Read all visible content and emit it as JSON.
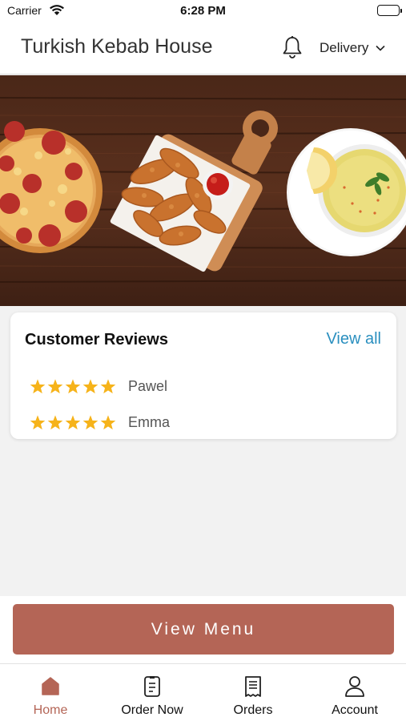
{
  "status_bar": {
    "carrier": "Carrier",
    "time": "6:28 PM"
  },
  "header": {
    "title": "Turkish Kebab House",
    "delivery_label": "Delivery"
  },
  "reviews": {
    "title": "Customer Reviews",
    "view_all": "View all",
    "items": [
      {
        "name": "Pawel",
        "rating": 5
      },
      {
        "name": "Emma",
        "rating": 5
      }
    ]
  },
  "actions": {
    "view_menu": "View Menu"
  },
  "tab_bar": {
    "items": [
      {
        "label": "Home",
        "icon": "home-icon",
        "active": true
      },
      {
        "label": "Order Now",
        "icon": "order-now-icon",
        "active": false
      },
      {
        "label": "Orders",
        "icon": "orders-receipt-icon",
        "active": false
      },
      {
        "label": "Account",
        "icon": "account-icon",
        "active": false
      }
    ]
  },
  "colors": {
    "accent": "#b46556",
    "link": "#2a8fbf",
    "star": "#f6b31a"
  }
}
